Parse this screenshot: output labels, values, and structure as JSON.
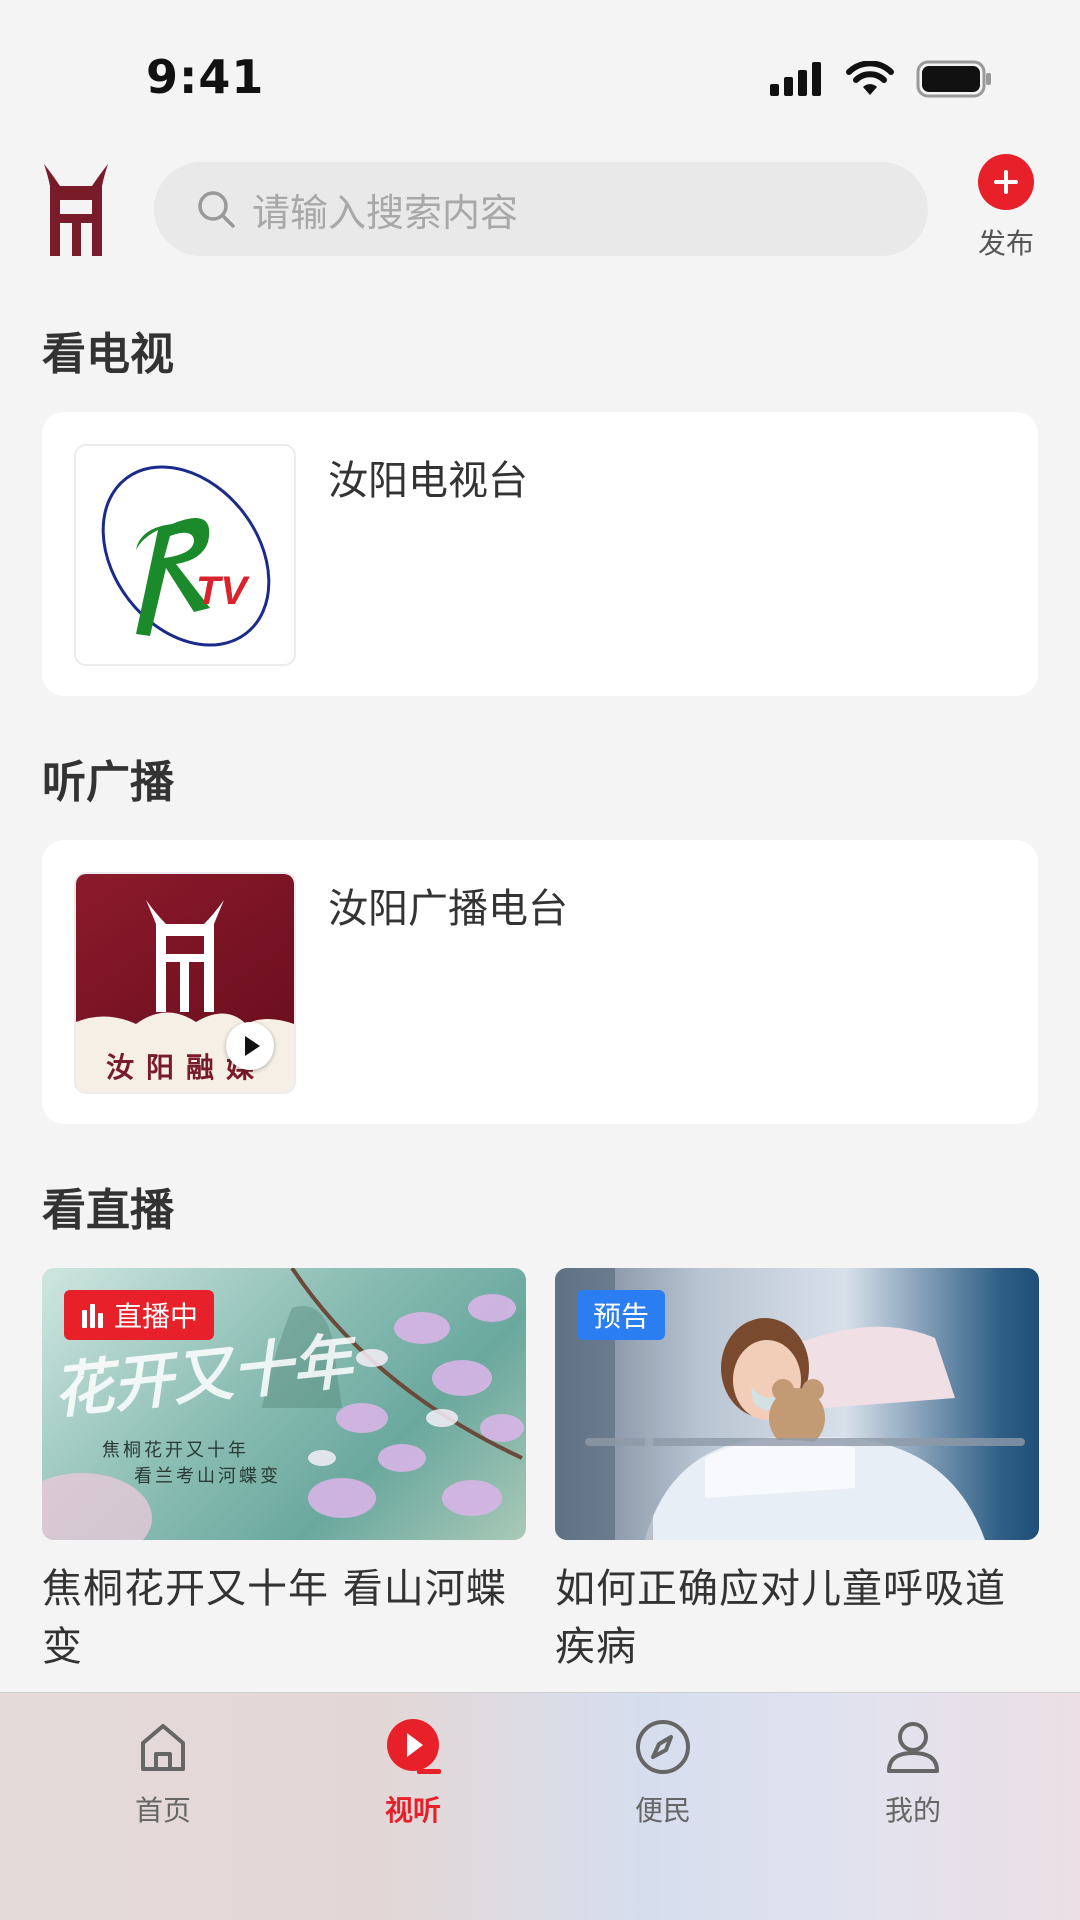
{
  "status_bar": {
    "time": "9:41"
  },
  "search": {
    "placeholder": "请输入搜索内容"
  },
  "header": {
    "publish_label": "发布"
  },
  "sections": {
    "tv": {
      "title": "看电视",
      "items": [
        {
          "name": "汝阳电视台"
        }
      ]
    },
    "radio": {
      "title": "听广播",
      "items": [
        {
          "name": "汝阳广播电台"
        }
      ]
    },
    "live": {
      "title": "看直播",
      "items": [
        {
          "badge": "直播中",
          "title": "焦桐花开又十年 看山河蝶变",
          "image_text_main": "花开又十年",
          "image_text_sub1": "焦桐花开又十年",
          "image_text_sub2": "看兰考山河蝶变"
        },
        {
          "badge": "预告",
          "title": "如何正确应对儿童呼吸道疾病"
        }
      ]
    }
  },
  "radio_logo_text": "汝阳融媒",
  "tabbar": {
    "tabs": [
      {
        "label": "首页",
        "icon": "home-icon",
        "active": false
      },
      {
        "label": "视听",
        "icon": "play-icon",
        "active": true
      },
      {
        "label": "便民",
        "icon": "compass-icon",
        "active": false
      },
      {
        "label": "我的",
        "icon": "user-icon",
        "active": false
      }
    ]
  },
  "colors": {
    "accent": "#e8202a",
    "preview_badge": "#2b7df2",
    "logo": "#7a1b2a"
  }
}
